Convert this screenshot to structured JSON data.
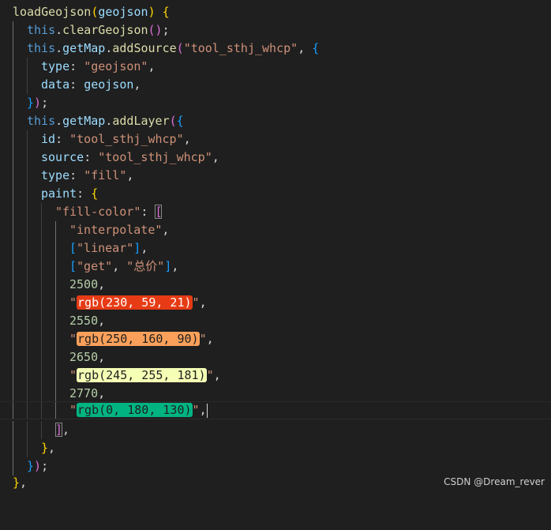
{
  "code": {
    "function_name": "loadGeojson",
    "param": "geojson",
    "this_kw": "this",
    "clear_fn": "clearGeojson",
    "getmap": "getMap",
    "add_source_fn": "addSource",
    "add_layer_fn": "addLayer",
    "source_id": "\"tool_sthj_whcp\"",
    "type_key": "type",
    "type_geojson": "\"geojson\"",
    "data_key": "data",
    "data_value": "geojson",
    "id_key": "id",
    "layer_id": "\"tool_sthj_whcp\"",
    "source_key": "source",
    "source_value": "\"tool_sthj_whcp\"",
    "type_fill": "\"fill\"",
    "paint_key": "paint",
    "fill_color_key": "\"fill-color\"",
    "interpolate": "\"interpolate\"",
    "linear": "\"linear\"",
    "get": "\"get\"",
    "price_field": "\"总价\"",
    "stops": [
      {
        "value": "2500",
        "color_text": "rgb(230, 59, 21)",
        "swatch": "#e63b15",
        "text_color": "#ffffff"
      },
      {
        "value": "2550",
        "color_text": "rgb(250, 160, 90)",
        "swatch": "#faa05a",
        "text_color": "#1f1f1f"
      },
      {
        "value": "2650",
        "color_text": "rgb(245, 255, 181)",
        "swatch": "#f5ffb5",
        "text_color": "#1f1f1f"
      },
      {
        "value": "2770",
        "color_text": "rgb(0, 180, 130)",
        "swatch": "#00b482",
        "text_color": "#1f1f1f"
      }
    ]
  },
  "watermark": "CSDN @Dream_rever",
  "colors": {
    "background": "#1f1f1f",
    "function": "#dcdcaa",
    "keyword": "#569cd6",
    "property": "#9cdcfe",
    "string": "#ce9178",
    "number": "#b5cea8"
  }
}
